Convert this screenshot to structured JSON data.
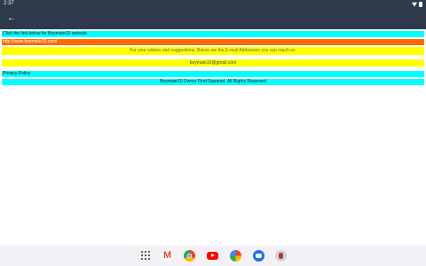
{
  "status_bar": {
    "time": "2:37"
  },
  "content": {
    "link_intro": "Click the link below for Boymate10 website.",
    "website_link": "http://www.boymate10.com/",
    "email_intro": "For your wishes and suggestions, Below are the E-mail Addresses you can reach us.",
    "email": "boymate10@gmail.com",
    "privacy_policy": "Privacy Policy",
    "copyright": "Boymate10 Owner Find-Squared. All Rights Reserved"
  },
  "colors": {
    "app_bar": "#2e3a4b",
    "cyan": "#00ffff",
    "orange": "#ff6a00",
    "yellow": "#ffff00"
  },
  "dock": {
    "icons": [
      "apps-grid-icon",
      "gmail-icon",
      "chrome-icon",
      "youtube-icon",
      "photos-icon",
      "messages-icon",
      "avatar-icon"
    ]
  }
}
